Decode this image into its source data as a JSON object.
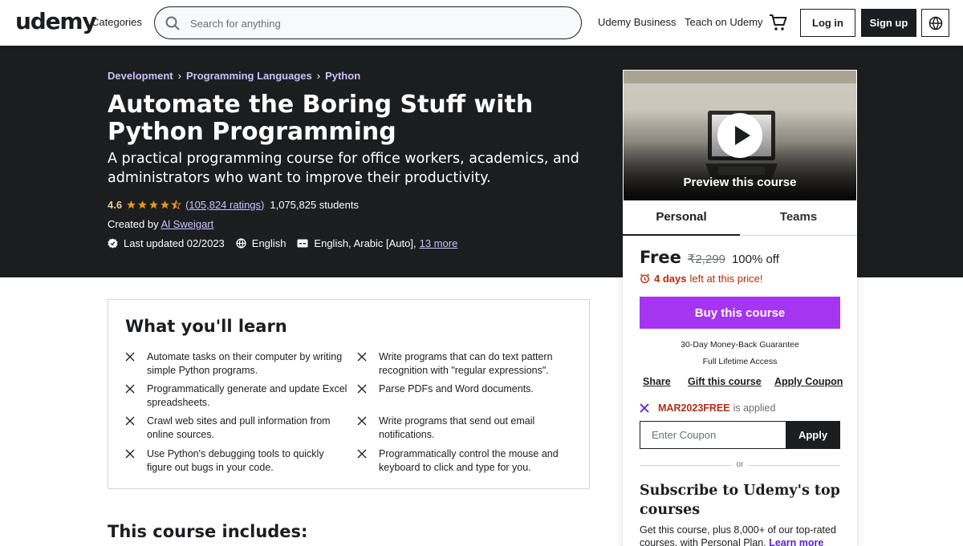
{
  "header": {
    "logo": "udemy",
    "categories": "Categories",
    "search_placeholder": "Search for anything",
    "udemy_business": "Udemy Business",
    "teach": "Teach on Udemy",
    "login": "Log in",
    "signup": "Sign up",
    "icons": [
      "search-icon",
      "cart-icon",
      "globe-icon"
    ]
  },
  "breadcrumb": [
    "Development",
    "Programming Languages",
    "Python"
  ],
  "course": {
    "title": "Automate the Boring Stuff with Python Programming",
    "subtitle": "A practical programming course for office workers, academics, and administrators who want to improve their productivity.",
    "rating": "4.6",
    "stars": 4.5,
    "ratings_count": "(105,824 ratings)",
    "students": "1,075,825 students",
    "created_by_label": "Created by",
    "instructor": "Al Sweigart",
    "last_updated": "Last updated 02/2023",
    "language": "English",
    "captions": "English, Arabic [Auto],",
    "more_captions": "13 more"
  },
  "card": {
    "preview_label": "Preview this course",
    "tabs": [
      "Personal",
      "Teams"
    ],
    "price": "Free",
    "original_price": "₹2,299",
    "discount": "100% off",
    "deadline_days": "4 days",
    "deadline_rest": "left at this price!",
    "buy": "Buy this course",
    "guarantee": "30-Day Money-Back Guarantee",
    "lifetime": "Full Lifetime Access",
    "share": "Share",
    "gift": "Gift this course",
    "apply_coupon": "Apply Coupon",
    "coupon_code": "MAR2023FREE",
    "coupon_applied": "is applied",
    "coupon_placeholder": "Enter Coupon",
    "apply": "Apply",
    "or": "or",
    "subscribe_title": "Subscribe to Udemy's top courses",
    "subscribe_text": "Get this course, plus 8,000+ of our top-rated courses, with Personal Plan.",
    "learn_more": "Learn more",
    "colors": {
      "buy": "#a435f0",
      "alert": "#b32d0f",
      "accent_link": "#cec0fc"
    }
  },
  "learn": {
    "title": "What you'll learn",
    "items": [
      "Automate tasks on their computer by writing simple Python programs.",
      "Write programs that can do text pattern recognition with \"regular expressions\".",
      "Programmatically generate and update Excel spreadsheets.",
      "Parse PDFs and Word documents.",
      "Crawl web sites and pull information from online sources.",
      "Write programs that send out email notifications.",
      "Use Python's debugging tools to quickly figure out bugs in your code.",
      "Programmatically control the mouse and keyboard to click and type for you."
    ]
  },
  "includes_title": "This course includes:"
}
